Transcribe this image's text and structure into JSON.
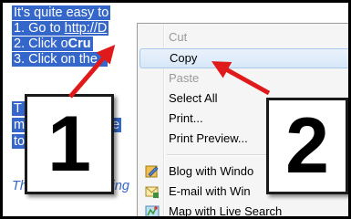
{
  "document": {
    "lines": [
      {
        "prefix": "It's quite easy to",
        "link": "",
        "bold": "",
        "suffix": ""
      },
      {
        "prefix": "1. Go to ",
        "link": "http://D",
        "bold": "",
        "suffix": ""
      },
      {
        "prefix": "2. Click o",
        "link": "",
        "bold": "Cru",
        "suffix": ""
      },
      {
        "prefix": "3. Click o",
        "link": "",
        "bold": "",
        "suffix": "n the \""
      },
      {
        "prefix": "T",
        "link": "",
        "bold": "",
        "suffix": "ther"
      },
      {
        "prefix": "m",
        "link": "",
        "bold": "",
        "suffix": "duce"
      },
      {
        "prefix": "to",
        "link": "",
        "bold": "",
        "suffix": ""
      }
    ],
    "plain_line": "Th",
    "plain_line_tail": "thing"
  },
  "context_menu": {
    "items": [
      {
        "label": "Cut",
        "disabled": true
      },
      {
        "label": "Copy",
        "highlighted": true
      },
      {
        "label": "Paste",
        "disabled": true
      },
      {
        "label": "Select All"
      },
      {
        "label": "Print..."
      },
      {
        "label": "Print Preview..."
      },
      {
        "label": "Blog with Windo",
        "icon": "blog-icon"
      },
      {
        "label": "E-mail with Win",
        "icon": "email-icon"
      },
      {
        "label": "Map with Live Search",
        "icon": "map-icon"
      }
    ]
  },
  "callouts": {
    "one": "1",
    "two": "2"
  },
  "colors": {
    "selection": "#3467c9",
    "arrow_red": "#e01a1a",
    "highlight_border": "#a8c8ec"
  }
}
